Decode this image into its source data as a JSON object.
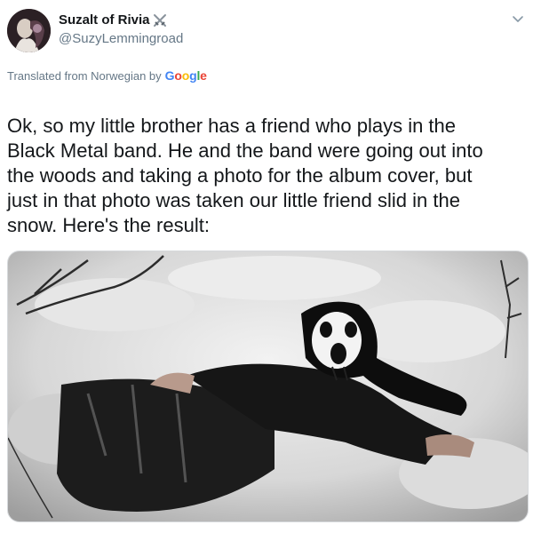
{
  "author": {
    "display_name": "Suzalt of Rivia",
    "handle": "@SuzyLemmingroad",
    "badge_icon": "crossed-swords-icon",
    "avatar_icon": "avatar-photo"
  },
  "menu_icon": "chevron-down-icon",
  "translation": {
    "label": "Translated from Norwegian by",
    "provider": "Google",
    "provider_colors": [
      "#4285F4",
      "#EA4335",
      "#FBBC05",
      "#4285F4",
      "#34A853",
      "#EA4335"
    ]
  },
  "tweet": {
    "lines": [
      "Ok, so my little brother has a friend who plays in the",
      "Black Metal band. He and the band were going out into",
      "the woods and taking a photo for the album cover, but",
      "just in that photo was taken our little friend slid in the",
      "snow. Here's the result:"
    ]
  },
  "media": {
    "type": "photo",
    "alt": ""
  },
  "colors": {
    "text": "#14171a",
    "secondary": "#657786",
    "border": "#d6d9dc"
  }
}
